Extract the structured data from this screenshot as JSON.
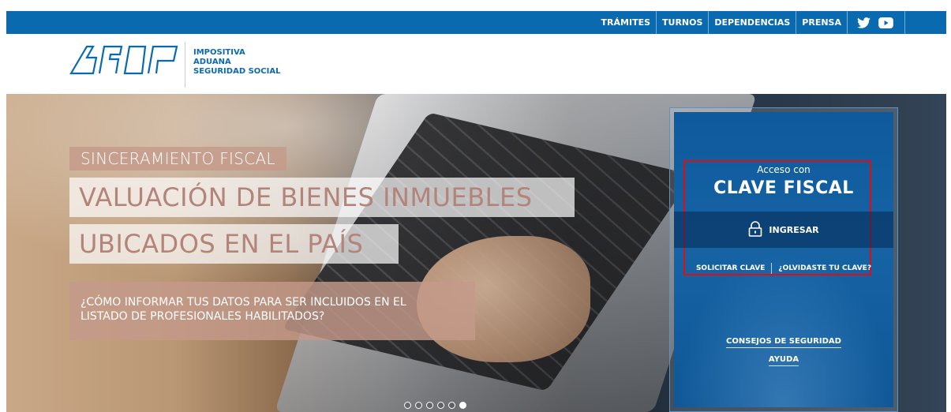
{
  "top_nav": {
    "items": [
      "TRÁMITES",
      "TURNOS",
      "DEPENDENCIAS",
      "PRENSA"
    ],
    "social": [
      "twitter-icon",
      "youtube-icon"
    ],
    "bar_color": "#0a6ab0"
  },
  "header": {
    "logo_icon": "afip-logo-icon",
    "lines": [
      "IMPOSITIVA",
      "ADUANA",
      "SEGURIDAD SOCIAL"
    ],
    "brand_color": "#0a6ab0"
  },
  "hero": {
    "tag": "SINCERAMIENTO FISCAL",
    "headline_1": "VALUACIÓN DE BIENES INMUEBLES",
    "headline_2": "UBICADOS EN EL PAÍS",
    "subtitle_line_1": "¿CÓMO INFORMAR TUS DATOS PARA SER INCLUIDOS EN EL",
    "subtitle_line_2": "LISTADO DE PROFESIONALES HABILITADOS?",
    "slide_count": 6,
    "active_slide": 6
  },
  "login_panel": {
    "access_label": "Acceso con",
    "access_title": "CLAVE FISCAL",
    "login_button": "INGRESAR",
    "lock_icon": "lock-icon",
    "request_key": "SOLICITAR CLAVE",
    "forgot_key": "¿OLVIDASTE TU CLAVE?",
    "security_tips": "CONSEJOS DE SEGURIDAD",
    "help": "AYUDA",
    "highlight_color": "#e00d12"
  }
}
